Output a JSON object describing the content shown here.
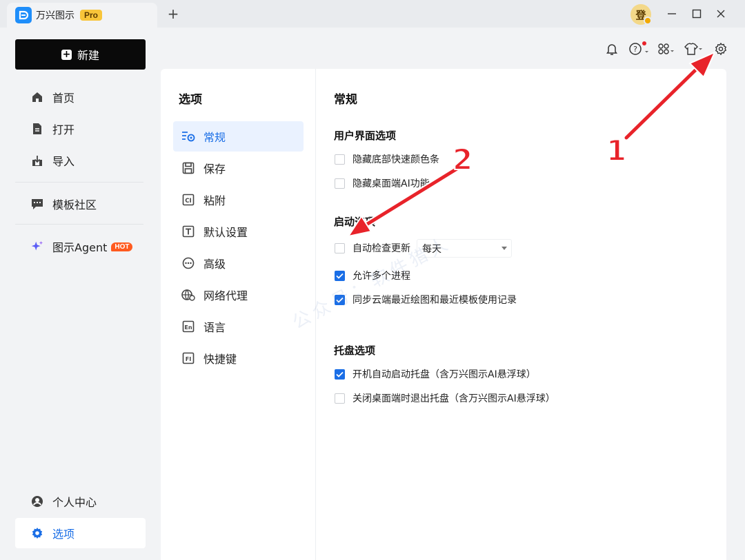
{
  "titlebar": {
    "app_name": "万兴图示",
    "badge": "Pro",
    "new_tab": "+",
    "avatar_char": "登"
  },
  "sidebar": {
    "new_button": "新建",
    "items": [
      {
        "label": "首页",
        "icon": "home-icon"
      },
      {
        "label": "打开",
        "icon": "file-icon"
      },
      {
        "label": "导入",
        "icon": "import-icon"
      },
      {
        "label": "模板社区",
        "icon": "community-icon"
      },
      {
        "label": "图示Agent",
        "icon": "sparkle-icon",
        "badge": "HOT"
      }
    ],
    "bottom_items": [
      {
        "label": "个人中心",
        "icon": "user-icon"
      },
      {
        "label": "选项",
        "icon": "gear-icon",
        "active": true
      }
    ]
  },
  "options": {
    "heading": "选项",
    "items": [
      {
        "label": "常规",
        "active": true
      },
      {
        "label": "保存"
      },
      {
        "label": "粘附"
      },
      {
        "label": "默认设置"
      },
      {
        "label": "高级"
      },
      {
        "label": "网络代理"
      },
      {
        "label": "语言"
      },
      {
        "label": "快捷键"
      }
    ]
  },
  "general": {
    "heading": "常规",
    "ui_section": {
      "title": "用户界面选项",
      "items": [
        {
          "label": "隐藏底部快速颜色条",
          "checked": false
        },
        {
          "label": "隐藏桌面端AI功能",
          "checked": false
        }
      ]
    },
    "startup_section": {
      "title": "启动选项",
      "auto_update": {
        "label": "自动检查更新",
        "checked": false,
        "frequency": "每天"
      },
      "items": [
        {
          "label": "允许多个进程",
          "checked": true
        },
        {
          "label": "同步云端最近绘图和最近模板使用记录",
          "checked": true
        }
      ]
    },
    "tray_section": {
      "title": "托盘选项",
      "items": [
        {
          "label": "开机自动启动托盘（含万兴图示AI悬浮球）",
          "checked": true
        },
        {
          "label": "关闭桌面端时退出托盘（含万兴图示AI悬浮球）",
          "checked": false
        }
      ]
    }
  },
  "annotations": {
    "marker1": "1",
    "marker2": "2"
  },
  "watermark": "公众号：软件猎人",
  "colors": {
    "accent": "#1a6ee6",
    "annotation": "#e8232a",
    "hot": "#ff5a1f",
    "pro": "#f8c53a"
  }
}
